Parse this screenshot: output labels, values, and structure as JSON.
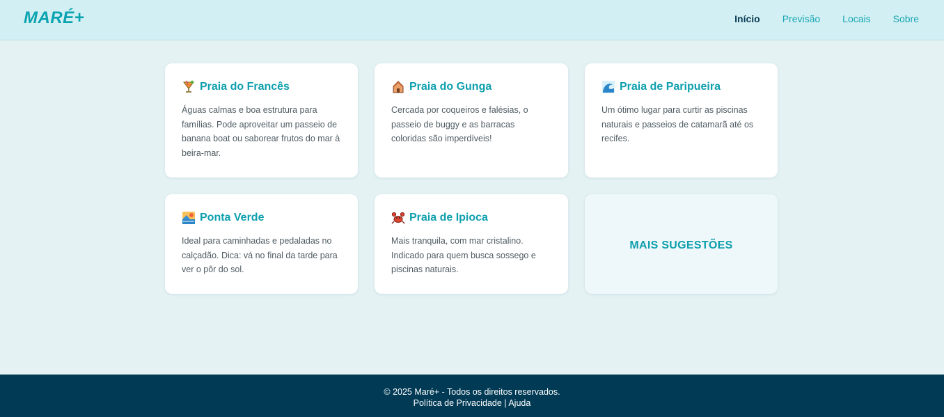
{
  "header": {
    "logo": "MARÉ+",
    "nav": [
      {
        "label": "Início",
        "active": true
      },
      {
        "label": "Previsão",
        "active": false
      },
      {
        "label": "Locais",
        "active": false
      },
      {
        "label": "Sobre",
        "active": false
      }
    ]
  },
  "cards": [
    {
      "icon": "tropical-drink-icon",
      "title": "Praia do Francês",
      "text": "Águas calmas e boa estrutura para famílias. Pode aproveitar um passeio de banana boat ou saborear frutos do mar à beira-mar."
    },
    {
      "icon": "hut-icon",
      "title": "Praia do Gunga",
      "text": "Cercada por coqueiros e falésias, o passeio de buggy e as barracas coloridas são imperdíveis!"
    },
    {
      "icon": "wave-icon",
      "title": "Praia de Paripueira",
      "text": "Um ótimo lugar para curtir as piscinas naturais e passeios de catamarã até os recifes."
    },
    {
      "icon": "sunset-icon",
      "title": "Ponta Verde",
      "text": "Ideal para caminhadas e pedaladas no calçadão. Dica: vá no final da tarde para ver o pôr do sol."
    },
    {
      "icon": "crab-icon",
      "title": "Praia de Ipioca",
      "text": "Mais tranquila, com mar cristalino. Indicado para quem busca sossego e piscinas naturais."
    }
  ],
  "more_suggestions": "MAIS SUGESTÕES",
  "footer": {
    "copyright": "© 2025 Maré+ - Todos os direitos reservados.",
    "privacy": "Política de Privacidade",
    "separator": "|",
    "help": "Ajuda"
  },
  "colors": {
    "accent": "#0e9fad",
    "header_bg": "#d2eff3",
    "page_bg": "#e4f2f4",
    "footer_bg": "#003a55",
    "nav_active": "#0b3d55"
  }
}
